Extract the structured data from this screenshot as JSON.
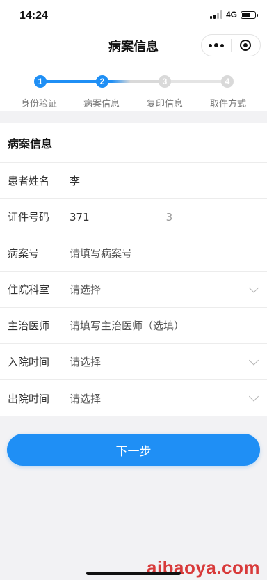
{
  "status_bar": {
    "time": "14:24",
    "network": "4G"
  },
  "nav": {
    "title": "病案信息"
  },
  "steps": [
    {
      "number": "1",
      "label": "身份验证",
      "state": "done"
    },
    {
      "number": "2",
      "label": "病案信息",
      "state": "active"
    },
    {
      "number": "3",
      "label": "复印信息",
      "state": "todo"
    },
    {
      "number": "4",
      "label": "取件方式",
      "state": "todo"
    }
  ],
  "colors": {
    "accent": "#1f8ff5",
    "inactive": "#d9d9d9",
    "watermark": "#d83a3a"
  },
  "form": {
    "section_title": "病案信息",
    "patient_name": {
      "label": "患者姓名",
      "value": "李"
    },
    "id_number": {
      "label": "证件号码",
      "value_prefix": "371",
      "value_suffix": "3"
    },
    "record_no": {
      "label": "病案号",
      "placeholder": "请填写病案号"
    },
    "department": {
      "label": "住院科室",
      "placeholder": "请选择"
    },
    "doctor": {
      "label": "主治医师",
      "placeholder": "请填写主治医师（选填）"
    },
    "admission_time": {
      "label": "入院时间",
      "placeholder": "请选择"
    },
    "discharge_time": {
      "label": "出院时间",
      "placeholder": "请选择"
    }
  },
  "next_button": {
    "label": "下一步"
  },
  "watermark": "aibaoya.com"
}
